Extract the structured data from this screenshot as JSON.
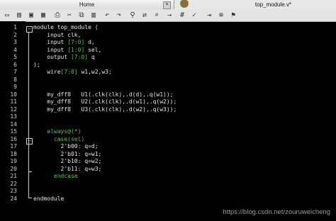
{
  "tabs": {
    "home": "Home",
    "file": "top_module.v*"
  },
  "toolbar": {
    "icons": [
      "new-file-icon",
      "open-folder-icon",
      "save-icon",
      "save-all-icon",
      "print-icon",
      "cut-icon",
      "copy-icon",
      "paste-icon",
      "undo-icon",
      "redo-icon",
      "find-icon",
      "replace-icon",
      "find-in-files-icon",
      "goto-icon",
      "hex-icon",
      "spellcheck-icon",
      "indent-icon",
      "format-icon",
      "bookmark-icon"
    ]
  },
  "editor": {
    "line_numbers": [
      "1",
      "2",
      "3",
      "4",
      "5",
      "6",
      "7",
      "8",
      "9",
      "10",
      "11",
      "12",
      "13",
      "14",
      "15",
      "16",
      "17",
      "18",
      "19",
      "20",
      "21",
      "22",
      "23",
      "24"
    ],
    "lines": [
      [
        {
          "t": "module top_module (",
          "c": "p"
        }
      ],
      [
        {
          "t": "    input clk,",
          "c": "p"
        }
      ],
      [
        {
          "t": "    input ",
          "c": "p"
        },
        {
          "t": "[7:0]",
          "c": "g"
        },
        {
          "t": " d,",
          "c": "p"
        }
      ],
      [
        {
          "t": "    input ",
          "c": "p"
        },
        {
          "t": "[1:0]",
          "c": "g"
        },
        {
          "t": " sel,",
          "c": "p"
        }
      ],
      [
        {
          "t": "    output ",
          "c": "p"
        },
        {
          "t": "[7:0]",
          "c": "g"
        },
        {
          "t": " q",
          "c": "p"
        }
      ],
      [
        {
          "t": ");",
          "c": "p"
        }
      ],
      [
        {
          "t": "    wire",
          "c": "p"
        },
        {
          "t": "[7:0]",
          "c": "g"
        },
        {
          "t": " w1,w2,w3;",
          "c": "p"
        }
      ],
      [],
      [],
      [
        {
          "t": "    my_dff8   U1(.clk(clk),.d(d),.q(w1));",
          "c": "p"
        }
      ],
      [
        {
          "t": "    my_dff8   U2(.clk(clk),.d(w1),.q(w2));",
          "c": "p"
        }
      ],
      [
        {
          "t": "    my_dff8   U3(.clk(clk),.d(w2),.q(w3));",
          "c": "p"
        }
      ],
      [],
      [],
      [
        {
          "t": "    always@(*)",
          "c": "g"
        }
      ],
      [
        {
          "t": "      case(sel)",
          "c": "g"
        }
      ],
      [
        {
          "t": "        2'b00: q=d;",
          "c": "p"
        }
      ],
      [
        {
          "t": "        2'b01: q=w1;",
          "c": "p"
        }
      ],
      [
        {
          "t": "        2'b10: q=w2;",
          "c": "p"
        }
      ],
      [
        {
          "t": "        2'b11: q=w3;",
          "c": "p"
        }
      ],
      [
        {
          "t": "      endcase",
          "c": "g"
        }
      ],
      [],
      [],
      [
        {
          "t": "endmodule",
          "c": "p"
        }
      ]
    ]
  },
  "watermark": "https://blog.csdn.net/zouruweicheng"
}
